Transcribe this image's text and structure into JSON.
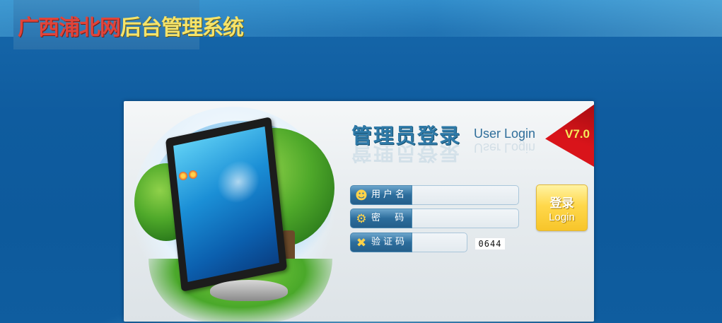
{
  "header": {
    "logo_part1": "广西浦北网",
    "logo_part2": "后台管理系统"
  },
  "login": {
    "title_cn": "管理员登录",
    "title_en": "User Login",
    "version": "V7.0",
    "username_label": "用户名",
    "username_value": "",
    "password_label": "密  码",
    "password_value": "",
    "captcha_label": "验证码",
    "captcha_value": "",
    "captcha_code": "0644",
    "button_cn": "登录",
    "button_en": "Login"
  },
  "colors": {
    "background": "#0f5c9f",
    "ribbon": "#d9141a",
    "version_text": "#f5ea5a",
    "button": "#ffd84b"
  },
  "icons": [
    "users-icon",
    "key-icon",
    "tools-icon"
  ]
}
